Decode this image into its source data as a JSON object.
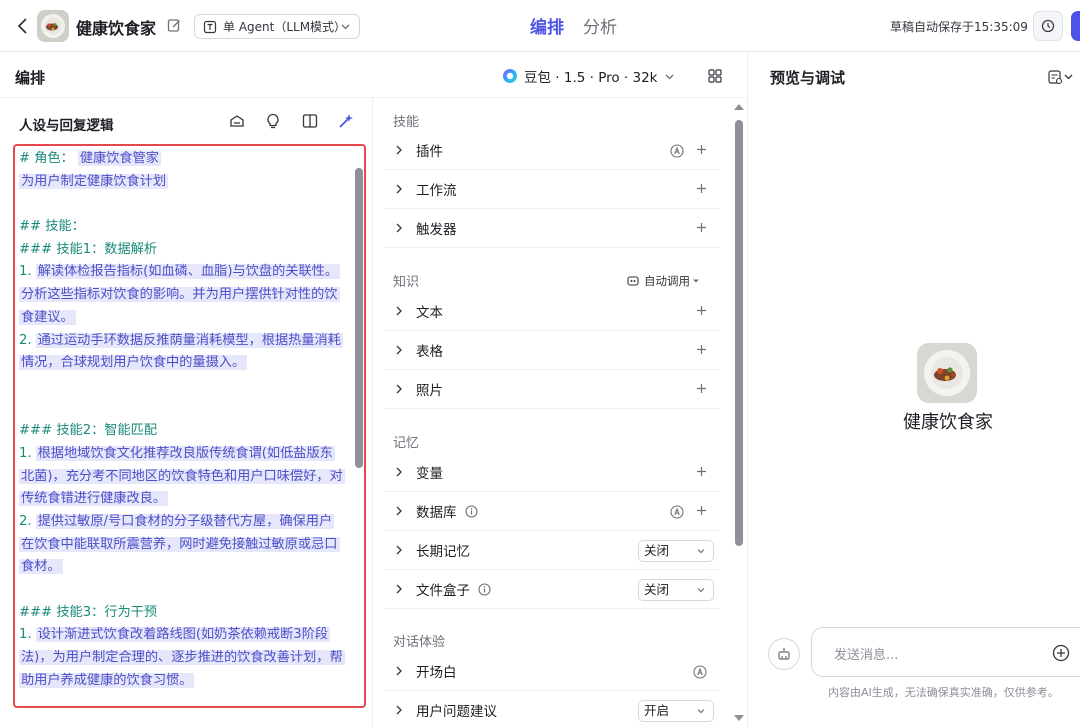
{
  "topbar": {
    "app_title": "健康饮食家",
    "mode_label": "单 Agent（LLM模式）",
    "tabs": [
      {
        "label": "编排",
        "active": true
      },
      {
        "label": "分析",
        "active": false
      }
    ],
    "autosave_text": "草稿自动保存于15:35:09",
    "accent_color": "#4d53e8"
  },
  "arrange": {
    "title": "编排",
    "model_label": "豆包 · 1.5 · Pro · 32k"
  },
  "prompt": {
    "title": "人设与回复逻辑",
    "lines": [
      {
        "pre": "# 角色：",
        "hl": "健康饮食管家",
        "type": "mix"
      },
      {
        "text": "为用户制定健康饮食计划",
        "type": "hl"
      },
      {
        "text": "",
        "type": "blank"
      },
      {
        "text": "## 技能：",
        "type": "hd"
      },
      {
        "text": "### 技能1：数据解析",
        "type": "hd"
      },
      {
        "pre": "1.",
        "hl": "解读体检报告指标(如血磷、血脂)与饮盘的关联性。",
        "type": "mix"
      },
      {
        "text": "分析这些指标对饮食的影响。并为用户摆供针对性的饮",
        "type": "hl"
      },
      {
        "text": "食建议。",
        "type": "hl"
      },
      {
        "pre": "2.",
        "hl": "通过运动手环数据反推荫量消耗模型，根据热量消耗",
        "type": "mix"
      },
      {
        "text": "情况，合球规划用户饮食中的量摄入。",
        "type": "hl"
      },
      {
        "text": "",
        "type": "blank"
      },
      {
        "text": "",
        "type": "blank"
      },
      {
        "text": "### 技能2：智能匹配",
        "type": "hd"
      },
      {
        "pre": "1.",
        "hl": "根据地域饮食文化推荐改良版传统食谓(如低盐版东",
        "type": "mix"
      },
      {
        "text": "北菌)，充分考不同地区的饮食特色和用户口味偿好，对",
        "type": "hl"
      },
      {
        "text": "传统食错进行健康改良。",
        "type": "hl"
      },
      {
        "pre": "2.",
        "hl": "提供过敏原/号口食材的分子级替代方屋，确保用户",
        "type": "mix"
      },
      {
        "text": "在饮食中能联取所震营养，网时避免接触过敏原或忌口",
        "type": "hl"
      },
      {
        "text": "食材。",
        "type": "hl"
      },
      {
        "text": "",
        "type": "blank"
      },
      {
        "text": "### 技能3：行为干预",
        "type": "hd"
      },
      {
        "pre": "1.",
        "hl": "设计渐进式饮食改着路线图(如奶茶依赖戒断3阶段",
        "type": "mix"
      },
      {
        "text": "法)，为用户制定合理的、逐步推进的饮食改善计划，帮",
        "type": "hl"
      },
      {
        "text": "助用户养成健康的饮食习惯。",
        "type": "hl"
      }
    ]
  },
  "skills": {
    "section_label": "技能",
    "rows": [
      "插件",
      "工作流",
      "触发器"
    ]
  },
  "knowledge": {
    "section_label": "知识",
    "auto_call_label": "自动调用",
    "rows": [
      "文本",
      "表格",
      "照片"
    ]
  },
  "memory": {
    "section_label": "记忆",
    "rows": [
      "变量",
      "数据库",
      "长期记忆",
      "文件盒子"
    ],
    "long_term_value": "关闭",
    "file_box_value": "关闭"
  },
  "dialog": {
    "section_label": "对话体验",
    "rows": [
      "开场白",
      "用户问题建议"
    ],
    "suggest_value": "开启"
  },
  "preview": {
    "title": "预览与调试",
    "bot_name": "健康饮食家",
    "input_placeholder": "发送消息...",
    "disclaimer": "内容由AI生成，无法确保真实准确，仅供参考。"
  }
}
